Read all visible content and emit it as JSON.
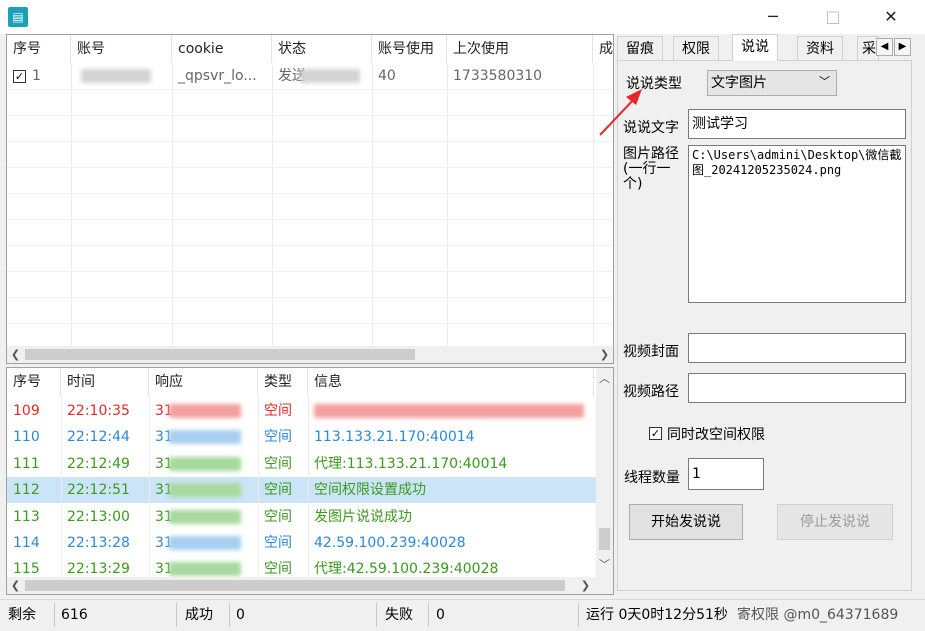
{
  "window": {
    "minimize": "─",
    "maximize": "□",
    "close": "✕"
  },
  "accounts": {
    "headers": [
      "序号",
      "账号",
      "cookie",
      "状态",
      "账号使用",
      "上次使用",
      "成"
    ],
    "rows": [
      {
        "index": "1",
        "account": "",
        "cookie": "_qpsvr_lo...",
        "status": "发送",
        "usage": "40",
        "last_used": "1733580310"
      }
    ]
  },
  "log": {
    "headers": [
      "序号",
      "时间",
      "响应",
      "类型",
      "信息"
    ],
    "rows": [
      {
        "index": "109",
        "time": "22:10:35",
        "resp": "31",
        "type": "空间",
        "info": "",
        "color": "#e8262a"
      },
      {
        "index": "110",
        "time": "22:12:44",
        "resp": "31",
        "type": "空间",
        "info": "113.133.21.170:40014",
        "color": "#2b88d8"
      },
      {
        "index": "111",
        "time": "22:12:49",
        "resp": "31",
        "type": "空间",
        "info": "代理:113.133.21.170:40014",
        "color": "#3c9a1e"
      },
      {
        "index": "112",
        "time": "22:12:51",
        "resp": "31",
        "type": "空间",
        "info": "空间权限设置成功",
        "color": "#3c9a1e"
      },
      {
        "index": "113",
        "time": "22:13:00",
        "resp": "31",
        "type": "空间",
        "info": "发图片说说成功",
        "color": "#3c9a1e"
      },
      {
        "index": "114",
        "time": "22:13:28",
        "resp": "31",
        "type": "空间",
        "info": "42.59.100.239:40028",
        "color": "#2b88d8"
      },
      {
        "index": "115",
        "time": "22:13:29",
        "resp": "31",
        "type": "空间",
        "info": "代理:42.59.100.239:40028",
        "color": "#3c9a1e"
      }
    ],
    "selected_row": 3
  },
  "tabs": [
    "留痕",
    "权限",
    "说说",
    "资料",
    "采"
  ],
  "tab_active": 2,
  "form": {
    "type_label": "说说类型",
    "type_value": "文字图片",
    "text_label": "说说文字",
    "text_value": "测试学习",
    "image_label": "图片路径\n(一行一个)",
    "image_value": "C:\\Users\\admini\\Desktop\\微信截图_20241205235024.png",
    "video_cover_label": "视频封面",
    "video_cover_value": "",
    "video_path_label": "视频路径",
    "video_path_value": "",
    "sync_perm_label": "同时改空间权限",
    "threads_label": "线程数量",
    "threads_value": "1",
    "start_button": "开始发说说",
    "stop_button": "停止发说说"
  },
  "status": {
    "remaining_label": "剩余",
    "remaining_value": "616",
    "success_label": "成功",
    "success_value": "0",
    "fail_label": "失败",
    "fail_value": "0",
    "runtime": "运行 0天0时12分51秒",
    "extra": "寄权限 @m0_64371689"
  }
}
